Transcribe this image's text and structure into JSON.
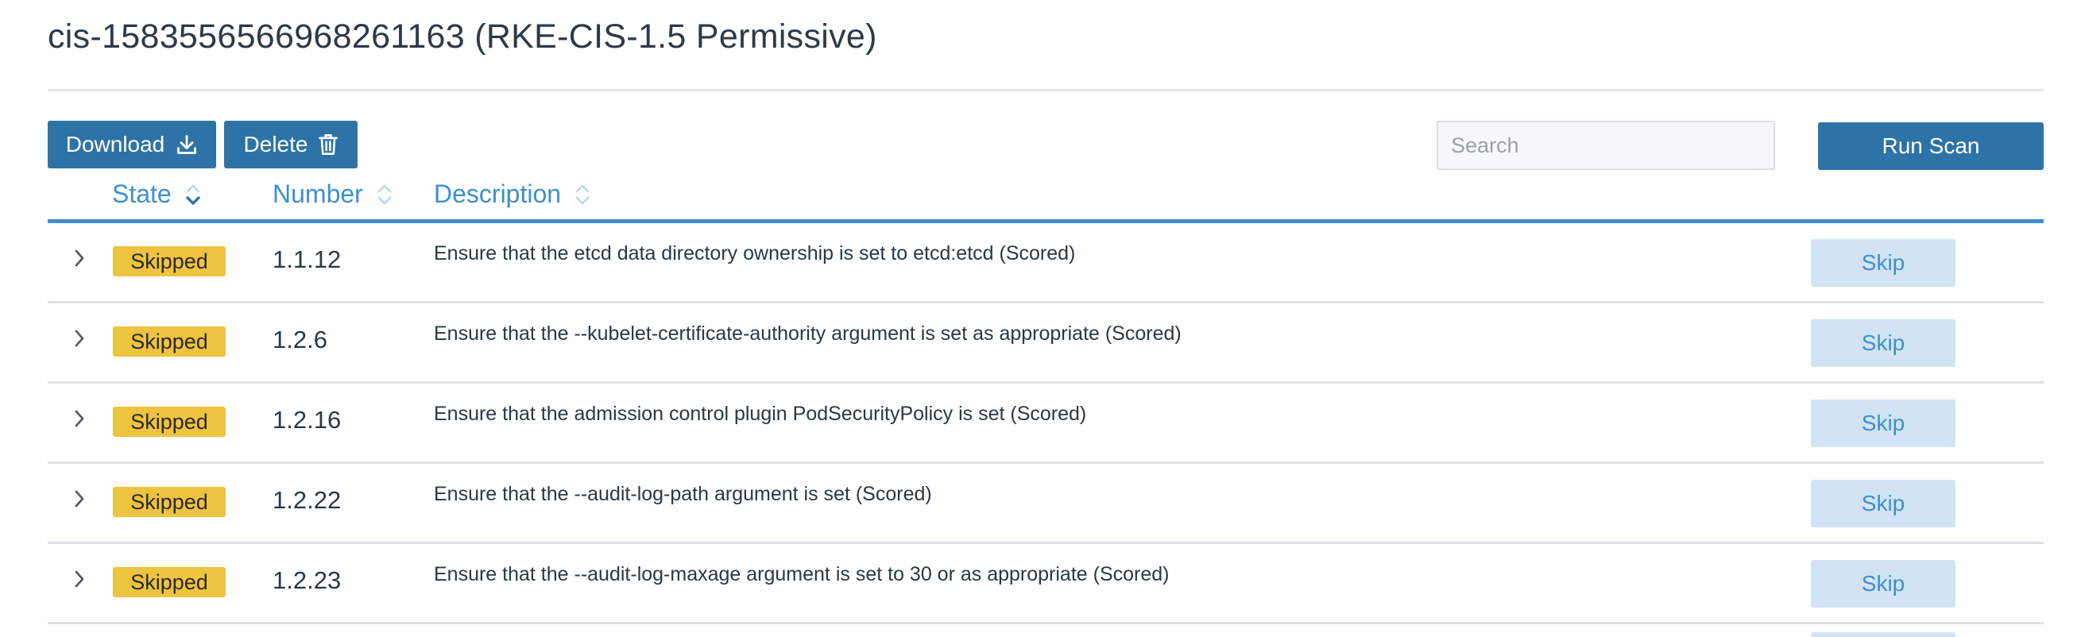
{
  "page": {
    "title": "cis-1583556566968261163 (RKE-CIS-1.5 Permissive)"
  },
  "toolbar": {
    "download_label": "Download",
    "delete_label": "Delete",
    "search_placeholder": "Search",
    "run_scan_label": "Run Scan"
  },
  "table": {
    "columns": [
      {
        "label": "State",
        "sort": "descending"
      },
      {
        "label": "Number",
        "sort": "none"
      },
      {
        "label": "Description",
        "sort": "none"
      }
    ],
    "rows": [
      {
        "state": "Skipped",
        "number": "1.1.12",
        "description": "Ensure that the etcd data directory ownership is set to etcd:etcd (Scored)",
        "action": "Skip"
      },
      {
        "state": "Skipped",
        "number": "1.2.6",
        "description": "Ensure that the --kubelet-certificate-authority argument is set as appropriate (Scored)",
        "action": "Skip"
      },
      {
        "state": "Skipped",
        "number": "1.2.16",
        "description": "Ensure that the admission control plugin PodSecurityPolicy is set (Scored)",
        "action": "Skip"
      },
      {
        "state": "Skipped",
        "number": "1.2.22",
        "description": "Ensure that the --audit-log-path argument is set (Scored)",
        "action": "Skip"
      },
      {
        "state": "Skipped",
        "number": "1.2.23",
        "description": "Ensure that the --audit-log-maxage argument is set to 30 or as appropriate (Scored)",
        "action": "Skip"
      }
    ]
  },
  "icons": {
    "download": "download-icon",
    "delete": "trash-icon",
    "sort": "sort-icon",
    "expand": "chevron-right-icon"
  },
  "colors": {
    "primary": "#2e73a7",
    "accent": "#3d8fd0",
    "badge_skipped": "#eec33f",
    "skip_button": "#d2e4f4"
  }
}
